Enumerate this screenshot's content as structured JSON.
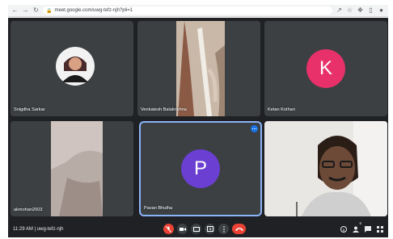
{
  "browser": {
    "url": "meet.google.com/uwg-tefz-njh?pli=1",
    "nav_back_icon": "back-arrow-icon",
    "nav_forward_icon": "forward-arrow-icon",
    "reload_icon": "reload-icon"
  },
  "participants": [
    {
      "name": "Snigdha Sarkar",
      "type": "photo"
    },
    {
      "name": "Venkatesh Balakrishna",
      "type": "video"
    },
    {
      "name": "Ketan Kothari",
      "type": "avatar",
      "initial": "K",
      "color": "#e8316b"
    },
    {
      "name": "akmohan2003",
      "type": "video"
    },
    {
      "name": "Pavan Bhutha",
      "type": "avatar",
      "initial": "P",
      "color": "#6a3fd1"
    },
    {
      "name": "",
      "type": "video"
    }
  ],
  "controlbar": {
    "time_label": "11:29 AM | uwg-tefz-njh",
    "participant_count": "6"
  },
  "colors": {
    "background": "#202124",
    "tile": "#3c4043",
    "active_border": "#8ab4f8",
    "hangup": "#ea4335"
  }
}
